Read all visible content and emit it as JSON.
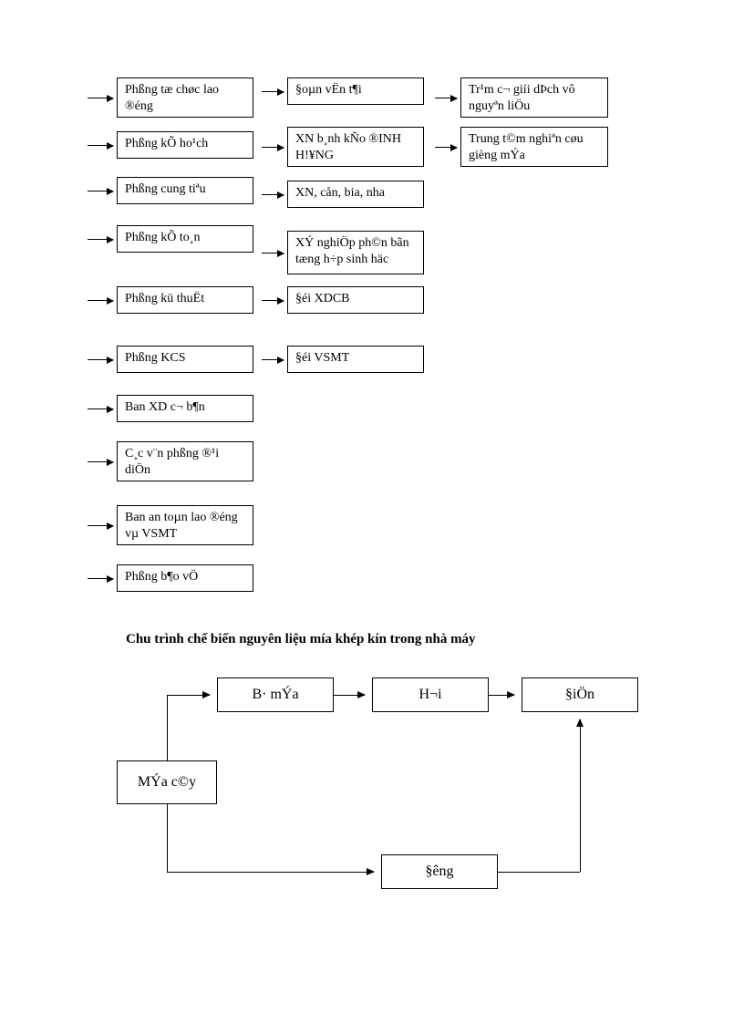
{
  "grid": {
    "col1": [
      "Phßng tæ chøc lao ®éng",
      "Phßng kÕ ho¹ch",
      "Phßng cung tiªu",
      "Phßng kÕ to¸n",
      "Phßng kü thuËt",
      "Phßng KCS",
      "Ban XD c¬ b¶n",
      "C¸c v¨n phßng ®¹i diÖn",
      "Ban an toµn lao ®éng vµ VSMT",
      "Phßng b¶o vÖ"
    ],
    "col2": [
      "§oµn vËn  t¶i",
      "XN b¸nh  kÑo ®INH H!¥NG",
      "XN, cån, bia, nha",
      "XÝ nghiÖp ph©n bãn tæng h÷p sinh häc",
      "§éi XDCB",
      "§éi VSMT"
    ],
    "col3": [
      "Tr¹m c¬ giíi  dÞch vô nguyªn liÖu",
      "Trung t©m nghiªn cøu gièng  mÝa"
    ]
  },
  "title": "Chu trình chế biến nguyên liệu  mía khép kín trong nhà máy",
  "flow": {
    "mia_cay": "MÝa c©y",
    "ba_mia": "B·  mÝa",
    "hoi": "H¬i",
    "dien": "§iÖn",
    "dong": "§êng"
  }
}
